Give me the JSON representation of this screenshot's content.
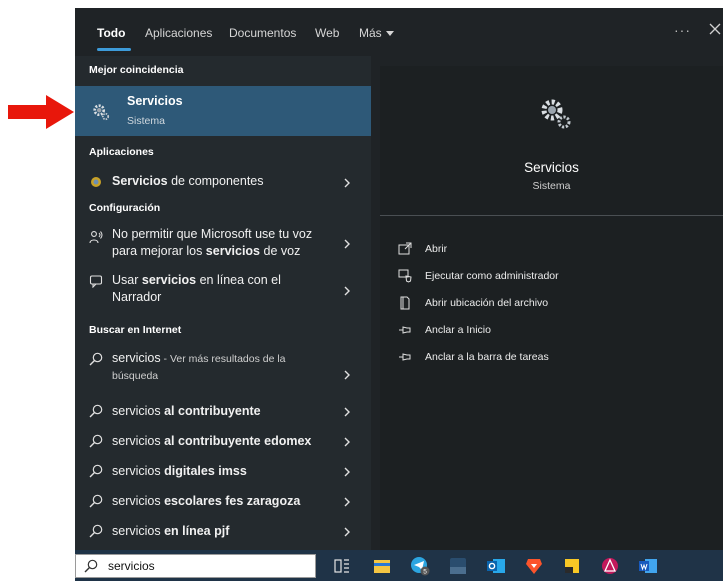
{
  "tabs": [
    {
      "label": "Todo",
      "active": true
    },
    {
      "label": "Aplicaciones",
      "active": false
    },
    {
      "label": "Documentos",
      "active": false
    },
    {
      "label": "Web",
      "active": false
    },
    {
      "label": "Más",
      "active": false
    }
  ],
  "more_options": "···",
  "best_match": {
    "header": "Mejor coincidencia",
    "title": "Servicios",
    "subtitle": "Sistema"
  },
  "apps": {
    "header": "Aplicaciones",
    "items": [
      {
        "bold": "Servicios",
        "rest": " de componentes"
      }
    ]
  },
  "settings": {
    "header": "Configuración",
    "items": [
      {
        "line1": "No permitir que Microsoft use tu voz",
        "line2_pre": "para mejorar los ",
        "line2_bold": "servicios",
        "line2_post": " de voz"
      },
      {
        "line1_pre": "Usar ",
        "line1_bold": "servicios",
        "line1_post": " en línea con el",
        "line2": "Narrador"
      }
    ]
  },
  "internet": {
    "header": "Buscar en Internet",
    "first": {
      "term": "servicios",
      "hint": " - Ver más resultados de la",
      "hint2": "búsqueda"
    },
    "items": [
      {
        "pre": "servicios ",
        "bold": "al contribuyente"
      },
      {
        "pre": "servicios ",
        "bold": "al contribuyente edomex"
      },
      {
        "pre": "servicios ",
        "bold": "digitales imss"
      },
      {
        "pre": "servicios ",
        "bold": "escolares fes zaragoza"
      },
      {
        "pre": "servicios ",
        "bold": "en línea pjf"
      }
    ]
  },
  "detail": {
    "title": "Servicios",
    "subtitle": "Sistema",
    "actions": [
      {
        "label": "Abrir",
        "icon": "open-icon"
      },
      {
        "label": "Ejecutar como administrador",
        "icon": "shield-icon"
      },
      {
        "label": "Abrir ubicación del archivo",
        "icon": "folder-icon"
      },
      {
        "label": "Anclar a Inicio",
        "icon": "pin-icon"
      },
      {
        "label": "Anclar a la barra de tareas",
        "icon": "pin-icon"
      }
    ]
  },
  "taskbar": {
    "search_value": "servicios",
    "badge": "5",
    "apps": [
      "task-view-icon",
      "file-explorer-icon",
      "telegram-icon",
      "3cx-icon",
      "outlook-icon",
      "brave-icon",
      "sticky-notes-icon",
      "archlinux-icon",
      "word-icon"
    ]
  },
  "colors": {
    "accent": "#3d9bd9",
    "selected_row": "#2e5978",
    "arrow": "#e8170b",
    "panel_bg": "#1f2326"
  }
}
